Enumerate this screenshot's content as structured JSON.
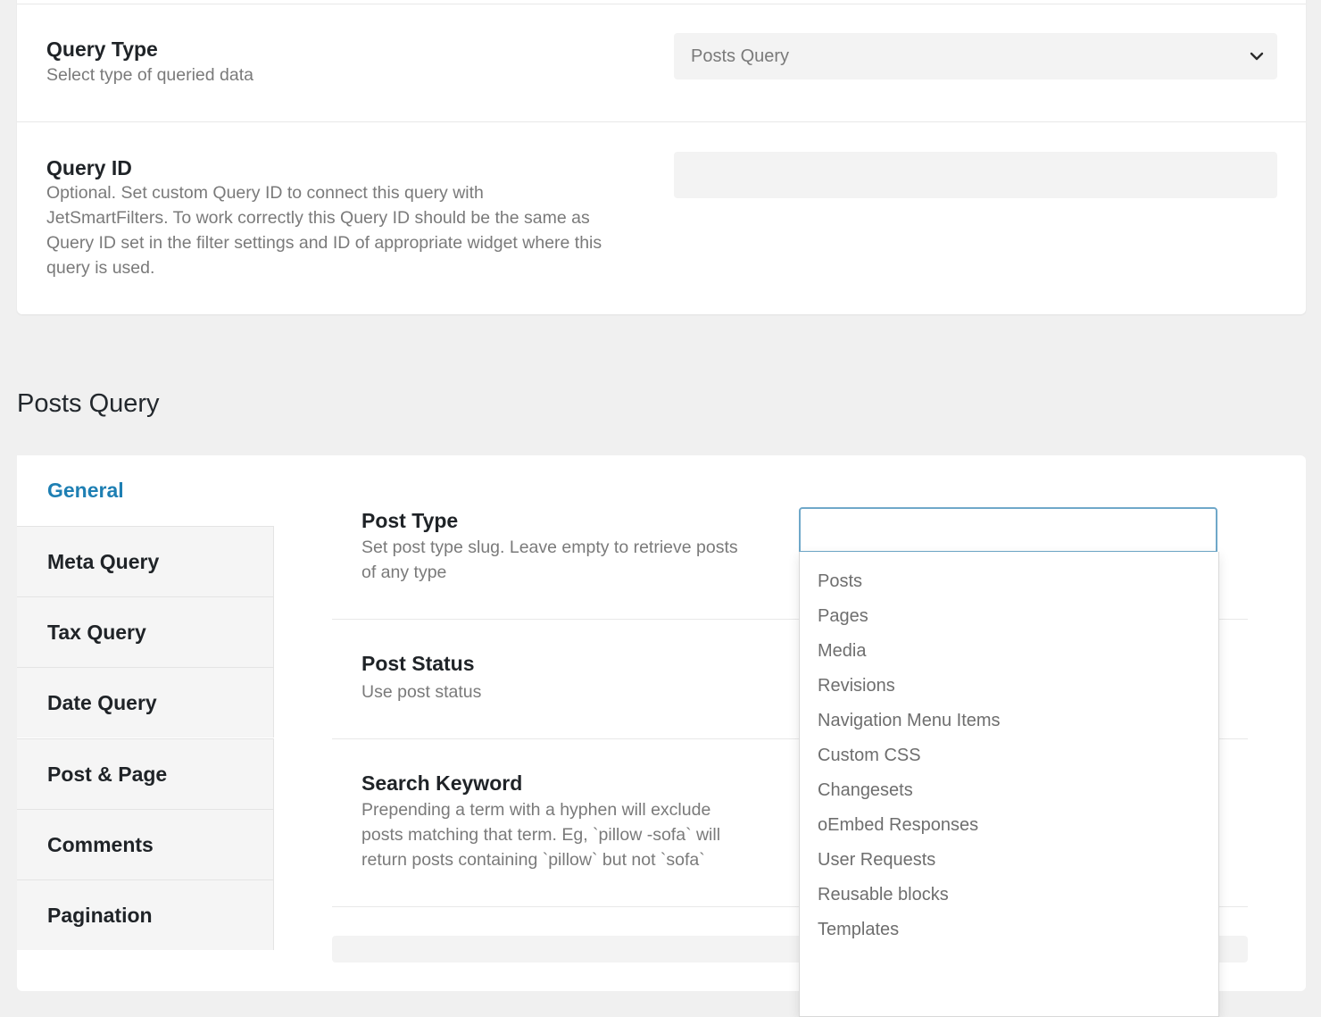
{
  "query_settings": {
    "query_type": {
      "label": "Query Type",
      "description": "Select type of queried data",
      "selected": "Posts Query"
    },
    "query_id": {
      "label": "Query ID",
      "description_lines": [
        "Optional. Set custom Query ID to connect this query with",
        "JetSmartFilters. To work correctly this Query ID should be the same as",
        "Query ID set in the filter settings and ID of appropriate widget where this",
        "query is used."
      ],
      "value": ""
    }
  },
  "section_title": "Posts Query",
  "tabs": [
    "General",
    "Meta Query",
    "Tax Query",
    "Date Query",
    "Post & Page",
    "Comments",
    "Pagination"
  ],
  "active_tab": "General",
  "fields": {
    "post_type": {
      "label": "Post Type",
      "description_lines": [
        "Set post type slug. Leave empty to retrieve posts",
        "of any type"
      ],
      "value": ""
    },
    "post_status": {
      "label": "Post Status",
      "description": "Use post status"
    },
    "search_keyword": {
      "label": "Search Keyword",
      "description_lines": [
        "Prepending a term with a hyphen will exclude",
        "posts matching that term. Eg, `pillow -sofa` will",
        "return posts containing `pillow` but not `sofa`"
      ]
    }
  },
  "post_type_options": [
    "Posts",
    "Pages",
    "Media",
    "Revisions",
    "Navigation Menu Items",
    "Custom CSS",
    "Changesets",
    "oEmbed Responses",
    "User Requests",
    "Reusable blocks",
    "Templates"
  ],
  "colors": {
    "background": "#f0f0f0",
    "card": "#ffffff",
    "accent": "#1e7fb3",
    "input_focus_border": "#6fa8c9"
  },
  "icons": {
    "select_arrow": "chevron-down-icon"
  }
}
